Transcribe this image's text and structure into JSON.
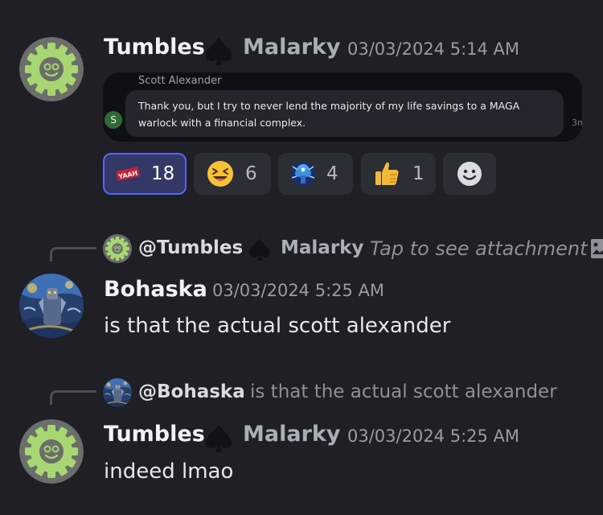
{
  "messages": [
    {
      "author_first": "Tumbles",
      "author_last": "Malarky",
      "timestamp": "03/03/2024 5:14 AM",
      "embed": {
        "name": "Scott Alexander",
        "text": "Thank you, but I try to never lend the majority of my life savings to a MAGA warlock with a financial complex.",
        "avatar_letter": "S",
        "time_partial": "3m"
      },
      "reactions": [
        {
          "icon": "yaaah-sticker-icon",
          "count": "18",
          "active": true
        },
        {
          "icon": "grinning-squinting-face-icon",
          "count": "6",
          "active": false
        },
        {
          "icon": "glowing-brain-icon",
          "count": "4",
          "active": false
        },
        {
          "icon": "thumbs-up-icon",
          "count": "1",
          "active": false
        }
      ],
      "add_reaction_icon": "add-reaction-smiley-icon"
    },
    {
      "reply": {
        "mention_first": "@Tumbles",
        "mention_last": "Malarky",
        "preview": "Tap to see attachment"
      },
      "author": "Bohaska",
      "timestamp": "03/03/2024 5:25 AM",
      "text": "is that the actual scott alexander"
    },
    {
      "reply": {
        "mention": "@Bohaska",
        "preview": "is that the actual scott alexander"
      },
      "author_first": "Tumbles",
      "author_last": "Malarky",
      "timestamp": "03/03/2024 5:25 AM",
      "text": "indeed lmao"
    }
  ],
  "colors": {
    "background": "#1f1f25",
    "active_reaction": "#5865f2",
    "gear_green": "#a8d672"
  }
}
